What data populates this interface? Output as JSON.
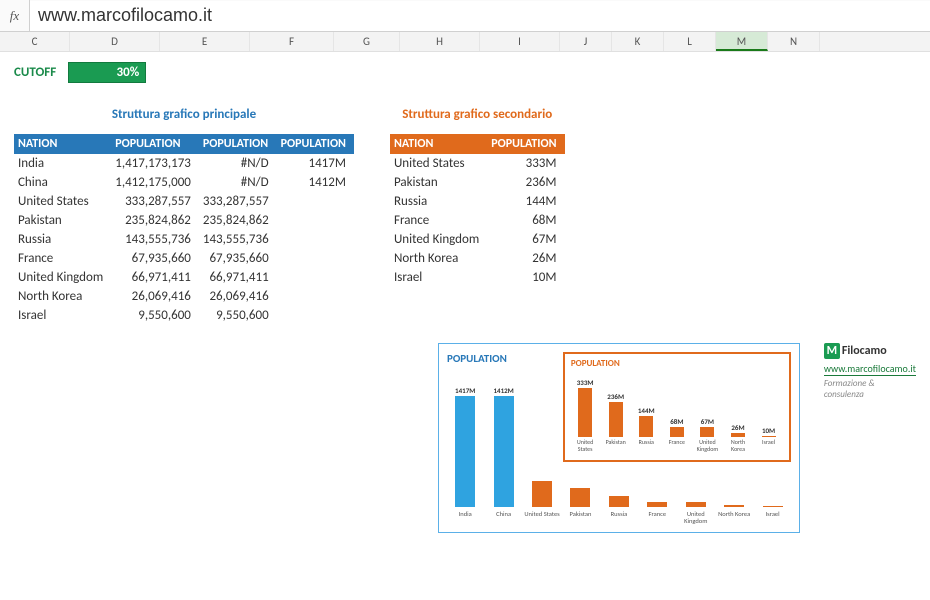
{
  "formula_bar": {
    "fx": "fx",
    "value": "www.marcofilocamo.it"
  },
  "columns": [
    "C",
    "D",
    "E",
    "F",
    "G",
    "H",
    "I",
    "J",
    "K",
    "L",
    "M",
    "N"
  ],
  "selected_col": "M",
  "cutoff": {
    "label": "CUTOFF",
    "value": "30%"
  },
  "table_main": {
    "title": "Struttura grafico principale",
    "headers": [
      "NATION",
      "POPULATION",
      "POPULATION",
      "POPULATION"
    ],
    "rows": [
      [
        "India",
        "1,417,173,173",
        "#N/D",
        "1417M"
      ],
      [
        "China",
        "1,412,175,000",
        "#N/D",
        "1412M"
      ],
      [
        "United States",
        "333,287,557",
        "333,287,557",
        ""
      ],
      [
        "Pakistan",
        "235,824,862",
        "235,824,862",
        ""
      ],
      [
        "Russia",
        "143,555,736",
        "143,555,736",
        ""
      ],
      [
        "France",
        "67,935,660",
        "67,935,660",
        ""
      ],
      [
        "United Kingdom",
        "66,971,411",
        "66,971,411",
        ""
      ],
      [
        "North Korea",
        "26,069,416",
        "26,069,416",
        ""
      ],
      [
        "Israel",
        "9,550,600",
        "9,550,600",
        ""
      ]
    ]
  },
  "table_sec": {
    "title": "Struttura grafico secondario",
    "headers": [
      "NATION",
      "POPULATION"
    ],
    "rows": [
      [
        "United States",
        "333M"
      ],
      [
        "Pakistan",
        "236M"
      ],
      [
        "Russia",
        "144M"
      ],
      [
        "France",
        "68M"
      ],
      [
        "United Kingdom",
        "67M"
      ],
      [
        "North Korea",
        "26M"
      ],
      [
        "Israel",
        "10M"
      ]
    ]
  },
  "chart_data": [
    {
      "type": "bar",
      "title": "POPULATION",
      "categories": [
        "India",
        "China",
        "United States",
        "Pakistan",
        "Russia",
        "France",
        "United Kingdom",
        "North Korea",
        "Israel"
      ],
      "series": [
        {
          "name": "blue",
          "values": [
            1417,
            1412,
            null,
            null,
            null,
            null,
            null,
            null,
            null
          ],
          "labels": [
            "1417M",
            "1412M",
            "",
            "",
            "",
            "",
            "",
            "",
            ""
          ]
        },
        {
          "name": "orange",
          "values": [
            null,
            null,
            333,
            236,
            144,
            68,
            67,
            26,
            10
          ],
          "labels": [
            "",
            "",
            "",
            "",
            "",
            "",
            "",
            "",
            ""
          ]
        }
      ],
      "ylim": [
        0,
        1500
      ]
    },
    {
      "type": "bar",
      "title": "POPULATION",
      "categories": [
        "United States",
        "Pakistan",
        "Russia",
        "France",
        "United Kingdom",
        "North Korea",
        "Israel"
      ],
      "values": [
        333,
        236,
        144,
        68,
        67,
        26,
        10
      ],
      "labels": [
        "333M",
        "236M",
        "144M",
        "68M",
        "67M",
        "26M",
        "10M"
      ],
      "ylim": [
        0,
        350
      ]
    }
  ],
  "logo": {
    "brand_m": "M",
    "brand_text": "Filocamo",
    "url": "www.marcofilocamo.it",
    "tagline": "Formazione & consulenza"
  }
}
